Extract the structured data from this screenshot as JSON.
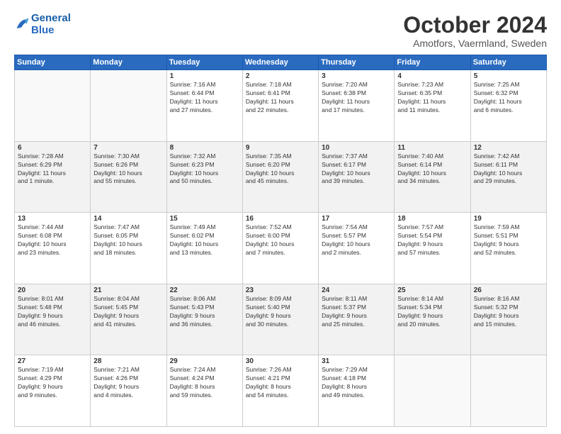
{
  "header": {
    "logo_line1": "General",
    "logo_line2": "Blue",
    "month": "October 2024",
    "location": "Amotfors, Vaermland, Sweden"
  },
  "weekdays": [
    "Sunday",
    "Monday",
    "Tuesday",
    "Wednesday",
    "Thursday",
    "Friday",
    "Saturday"
  ],
  "weeks": [
    [
      {
        "day": "",
        "info": ""
      },
      {
        "day": "",
        "info": ""
      },
      {
        "day": "1",
        "info": "Sunrise: 7:16 AM\nSunset: 6:44 PM\nDaylight: 11 hours\nand 27 minutes."
      },
      {
        "day": "2",
        "info": "Sunrise: 7:18 AM\nSunset: 6:41 PM\nDaylight: 11 hours\nand 22 minutes."
      },
      {
        "day": "3",
        "info": "Sunrise: 7:20 AM\nSunset: 6:38 PM\nDaylight: 11 hours\nand 17 minutes."
      },
      {
        "day": "4",
        "info": "Sunrise: 7:23 AM\nSunset: 6:35 PM\nDaylight: 11 hours\nand 11 minutes."
      },
      {
        "day": "5",
        "info": "Sunrise: 7:25 AM\nSunset: 6:32 PM\nDaylight: 11 hours\nand 6 minutes."
      }
    ],
    [
      {
        "day": "6",
        "info": "Sunrise: 7:28 AM\nSunset: 6:29 PM\nDaylight: 11 hours\nand 1 minute."
      },
      {
        "day": "7",
        "info": "Sunrise: 7:30 AM\nSunset: 6:26 PM\nDaylight: 10 hours\nand 55 minutes."
      },
      {
        "day": "8",
        "info": "Sunrise: 7:32 AM\nSunset: 6:23 PM\nDaylight: 10 hours\nand 50 minutes."
      },
      {
        "day": "9",
        "info": "Sunrise: 7:35 AM\nSunset: 6:20 PM\nDaylight: 10 hours\nand 45 minutes."
      },
      {
        "day": "10",
        "info": "Sunrise: 7:37 AM\nSunset: 6:17 PM\nDaylight: 10 hours\nand 39 minutes."
      },
      {
        "day": "11",
        "info": "Sunrise: 7:40 AM\nSunset: 6:14 PM\nDaylight: 10 hours\nand 34 minutes."
      },
      {
        "day": "12",
        "info": "Sunrise: 7:42 AM\nSunset: 6:11 PM\nDaylight: 10 hours\nand 29 minutes."
      }
    ],
    [
      {
        "day": "13",
        "info": "Sunrise: 7:44 AM\nSunset: 6:08 PM\nDaylight: 10 hours\nand 23 minutes."
      },
      {
        "day": "14",
        "info": "Sunrise: 7:47 AM\nSunset: 6:05 PM\nDaylight: 10 hours\nand 18 minutes."
      },
      {
        "day": "15",
        "info": "Sunrise: 7:49 AM\nSunset: 6:02 PM\nDaylight: 10 hours\nand 13 minutes."
      },
      {
        "day": "16",
        "info": "Sunrise: 7:52 AM\nSunset: 6:00 PM\nDaylight: 10 hours\nand 7 minutes."
      },
      {
        "day": "17",
        "info": "Sunrise: 7:54 AM\nSunset: 5:57 PM\nDaylight: 10 hours\nand 2 minutes."
      },
      {
        "day": "18",
        "info": "Sunrise: 7:57 AM\nSunset: 5:54 PM\nDaylight: 9 hours\nand 57 minutes."
      },
      {
        "day": "19",
        "info": "Sunrise: 7:59 AM\nSunset: 5:51 PM\nDaylight: 9 hours\nand 52 minutes."
      }
    ],
    [
      {
        "day": "20",
        "info": "Sunrise: 8:01 AM\nSunset: 5:48 PM\nDaylight: 9 hours\nand 46 minutes."
      },
      {
        "day": "21",
        "info": "Sunrise: 8:04 AM\nSunset: 5:45 PM\nDaylight: 9 hours\nand 41 minutes."
      },
      {
        "day": "22",
        "info": "Sunrise: 8:06 AM\nSunset: 5:43 PM\nDaylight: 9 hours\nand 36 minutes."
      },
      {
        "day": "23",
        "info": "Sunrise: 8:09 AM\nSunset: 5:40 PM\nDaylight: 9 hours\nand 30 minutes."
      },
      {
        "day": "24",
        "info": "Sunrise: 8:11 AM\nSunset: 5:37 PM\nDaylight: 9 hours\nand 25 minutes."
      },
      {
        "day": "25",
        "info": "Sunrise: 8:14 AM\nSunset: 5:34 PM\nDaylight: 9 hours\nand 20 minutes."
      },
      {
        "day": "26",
        "info": "Sunrise: 8:16 AM\nSunset: 5:32 PM\nDaylight: 9 hours\nand 15 minutes."
      }
    ],
    [
      {
        "day": "27",
        "info": "Sunrise: 7:19 AM\nSunset: 4:29 PM\nDaylight: 9 hours\nand 9 minutes."
      },
      {
        "day": "28",
        "info": "Sunrise: 7:21 AM\nSunset: 4:26 PM\nDaylight: 9 hours\nand 4 minutes."
      },
      {
        "day": "29",
        "info": "Sunrise: 7:24 AM\nSunset: 4:24 PM\nDaylight: 8 hours\nand 59 minutes."
      },
      {
        "day": "30",
        "info": "Sunrise: 7:26 AM\nSunset: 4:21 PM\nDaylight: 8 hours\nand 54 minutes."
      },
      {
        "day": "31",
        "info": "Sunrise: 7:29 AM\nSunset: 4:18 PM\nDaylight: 8 hours\nand 49 minutes."
      },
      {
        "day": "",
        "info": ""
      },
      {
        "day": "",
        "info": ""
      }
    ]
  ]
}
